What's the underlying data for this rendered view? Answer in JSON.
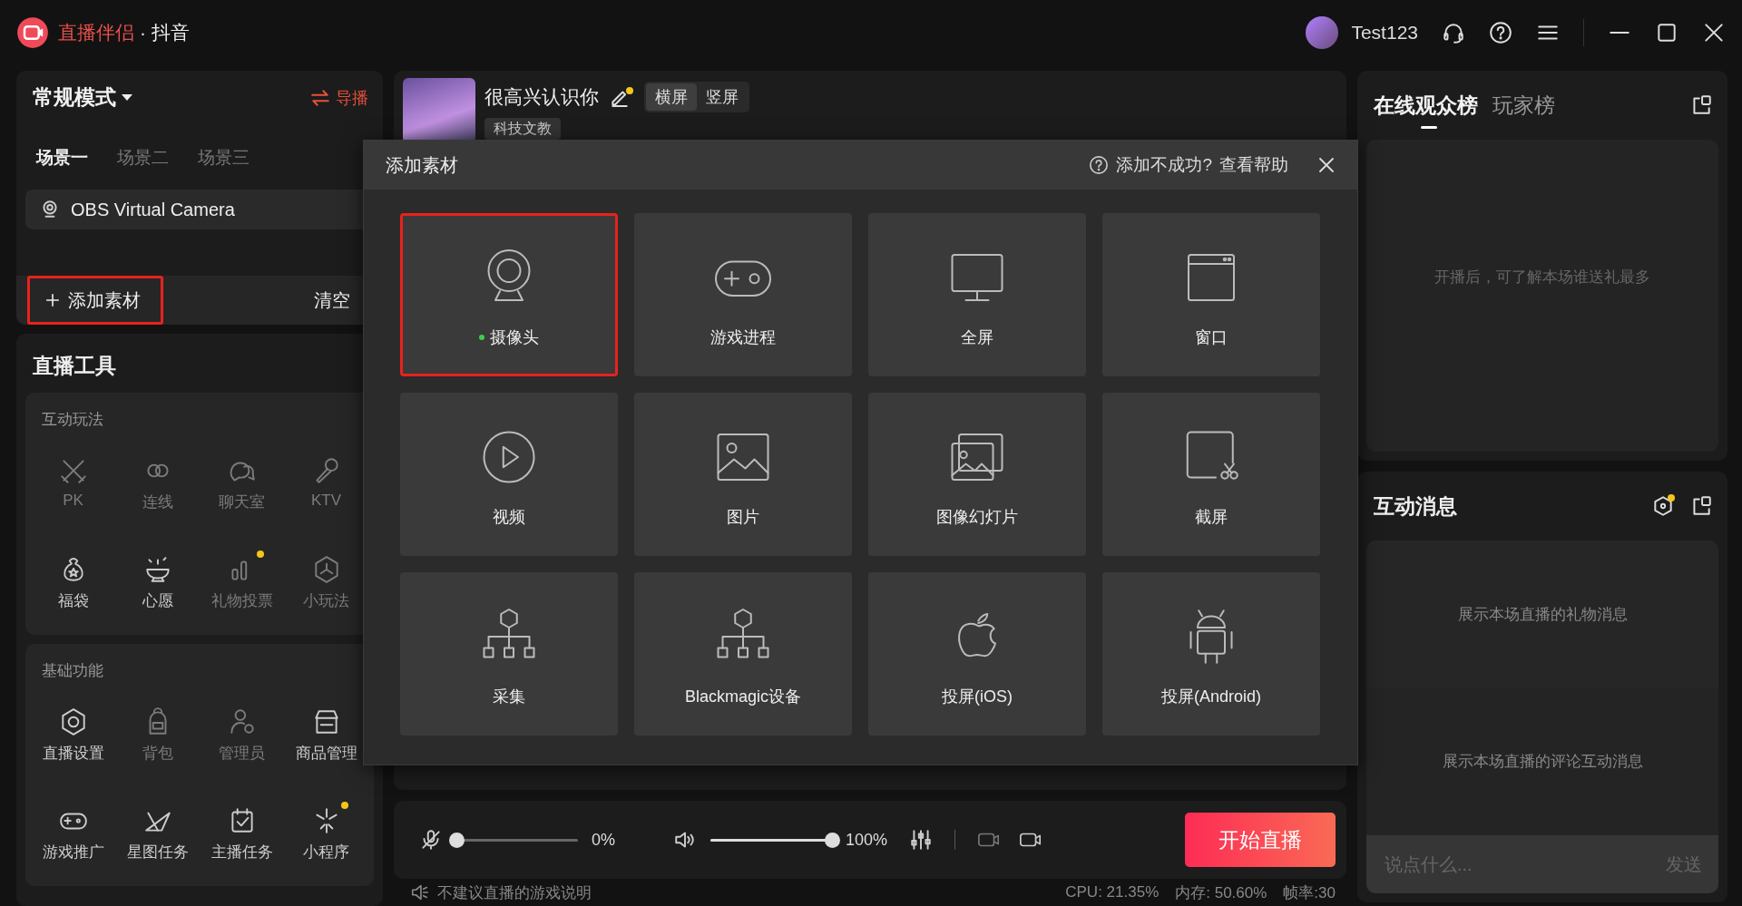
{
  "titlebar": {
    "app_name": "直播伴侣",
    "platform": "· 抖音",
    "username": "Test123"
  },
  "left": {
    "mode": "常规模式",
    "switch_label": "导播",
    "scenes": [
      {
        "label": "场景一",
        "selected": true
      },
      {
        "label": "场景二",
        "selected": false
      },
      {
        "label": "场景三",
        "selected": false
      }
    ],
    "sources": [
      {
        "name": "OBS Virtual Camera"
      }
    ],
    "add_button": {
      "label": "添加素材",
      "highlighted": true
    },
    "clear_label": "清空"
  },
  "tools": {
    "title": "直播工具",
    "sections": [
      {
        "title": "互动玩法",
        "items": [
          {
            "label": "PK",
            "disabled": true,
            "badge": false
          },
          {
            "label": "连线",
            "disabled": true,
            "badge": false
          },
          {
            "label": "聊天室",
            "disabled": true,
            "badge": false
          },
          {
            "label": "KTV",
            "disabled": true,
            "badge": false
          },
          {
            "label": "福袋",
            "disabled": false,
            "badge": false
          },
          {
            "label": "心愿",
            "disabled": false,
            "badge": false
          },
          {
            "label": "礼物投票",
            "disabled": true,
            "badge": true
          },
          {
            "label": "小玩法",
            "disabled": true,
            "badge": false
          }
        ]
      },
      {
        "title": "基础功能",
        "items": [
          {
            "label": "直播设置",
            "disabled": false,
            "badge": false
          },
          {
            "label": "背包",
            "disabled": true,
            "badge": false
          },
          {
            "label": "管理员",
            "disabled": true,
            "badge": false
          },
          {
            "label": "商品管理",
            "disabled": false,
            "badge": false
          },
          {
            "label": "游戏推广",
            "disabled": false,
            "badge": false
          },
          {
            "label": "星图任务",
            "disabled": false,
            "badge": false
          },
          {
            "label": "主播任务",
            "disabled": false,
            "badge": false
          },
          {
            "label": "小程序",
            "disabled": false,
            "badge": true
          }
        ]
      }
    ]
  },
  "stream": {
    "title": "很高兴认识你",
    "edit_badge": true,
    "orientations": [
      {
        "label": "横屏",
        "selected": true
      },
      {
        "label": "竖屏",
        "selected": false
      }
    ],
    "category": "科技文教"
  },
  "dialog": {
    "title": "添加素材",
    "help_question": "添加不成功?",
    "help_link": "查看帮助",
    "sources": [
      {
        "label": "摄像头",
        "active": true,
        "highlighted": true
      },
      {
        "label": "游戏进程",
        "active": false,
        "highlighted": false
      },
      {
        "label": "全屏",
        "active": false,
        "highlighted": false
      },
      {
        "label": "窗口",
        "active": false,
        "highlighted": false
      },
      {
        "label": "视频",
        "active": false,
        "highlighted": false
      },
      {
        "label": "图片",
        "active": false,
        "highlighted": false
      },
      {
        "label": "图像幻灯片",
        "active": false,
        "highlighted": false
      },
      {
        "label": "截屏",
        "active": false,
        "highlighted": false
      },
      {
        "label": "采集",
        "active": false,
        "highlighted": false
      },
      {
        "label": "Blackmagic设备",
        "active": false,
        "highlighted": false
      },
      {
        "label": "投屏(iOS)",
        "active": false,
        "highlighted": false
      },
      {
        "label": "投屏(Android)",
        "active": false,
        "highlighted": false
      }
    ]
  },
  "controls": {
    "mic": {
      "muted": true,
      "level": 0,
      "reading": "0%"
    },
    "speaker": {
      "level": 1,
      "reading": "100%"
    },
    "start_button": "开始直播"
  },
  "status_bar": {
    "notice": "不建议直播的游戏说明",
    "cpu": "CPU: 21.35%",
    "memory": "内存: 50.60%",
    "fps": "帧率:30"
  },
  "right": {
    "ranking_tabs": [
      {
        "label": "在线观众榜",
        "selected": true
      },
      {
        "label": "玩家榜",
        "selected": false
      }
    ],
    "ranking_empty": "开播后，可了解本场谁送礼最多",
    "messages": {
      "title": "互动消息",
      "settings_badge": true,
      "gift_empty": "展示本场直播的礼物消息",
      "comment_empty": "展示本场直播的评论互动消息",
      "input_placeholder": "说点什么...",
      "send": "发送"
    }
  }
}
